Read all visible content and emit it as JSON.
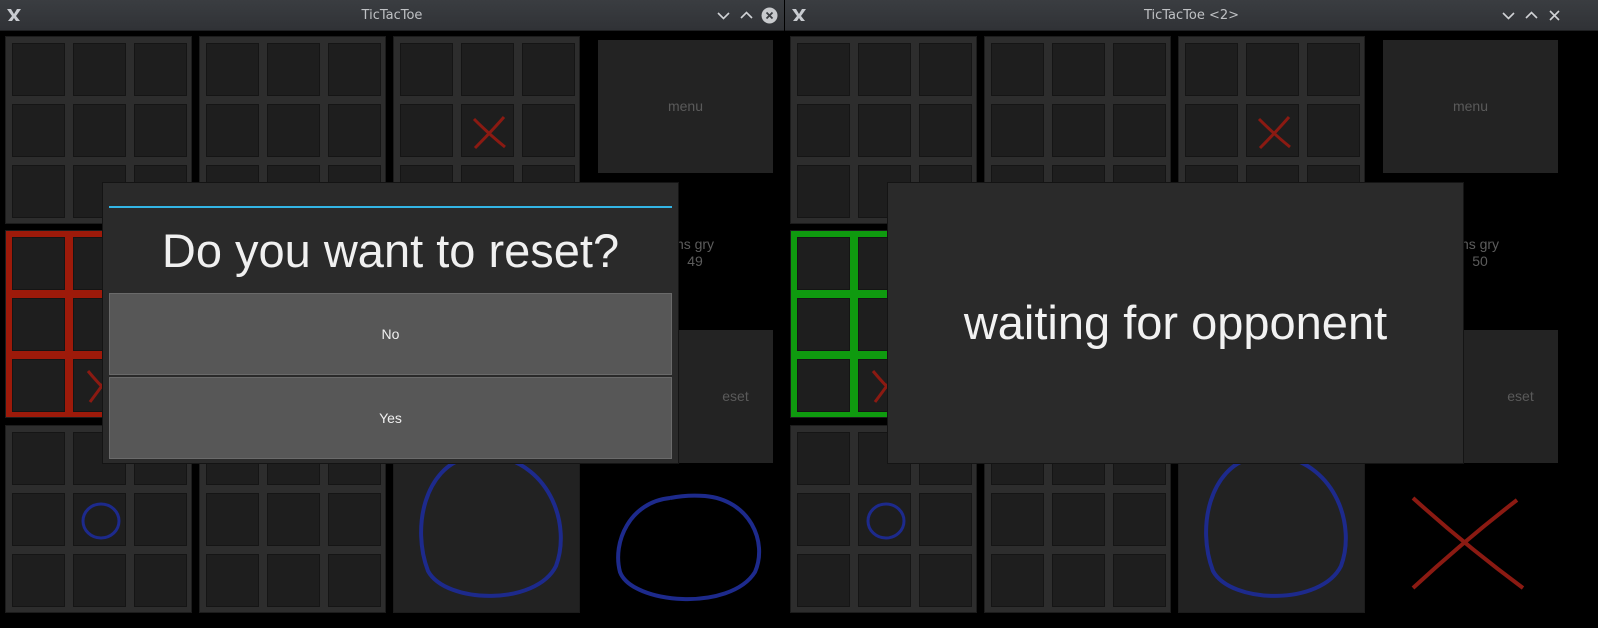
{
  "window1": {
    "title": "TicTacToe",
    "menu_label": "menu",
    "score_label": "ns gry",
    "score_value": "49",
    "reset_label": "eset"
  },
  "window2": {
    "title": "TicTacToe <2>",
    "menu_label": "menu",
    "score_label": "ns gry",
    "score_value": "50",
    "reset_label": "eset"
  },
  "reset_dialog": {
    "question": "Do you want to reset?",
    "no_label": "No",
    "yes_label": "Yes"
  },
  "waiting_dialog": {
    "message": "waiting for opponent"
  },
  "colors": {
    "accent_line": "#33b5e5",
    "x_mark": "#8b1a12",
    "o_mark": "#1d2a8c",
    "won_board_red": "#9d1a0a",
    "won_board_green": "#0f9a0f"
  },
  "icons": {
    "app": "kde-logo-icon",
    "minimize": "chevron-down-icon",
    "maximize": "chevron-up-icon",
    "close": "close-circle-icon"
  }
}
